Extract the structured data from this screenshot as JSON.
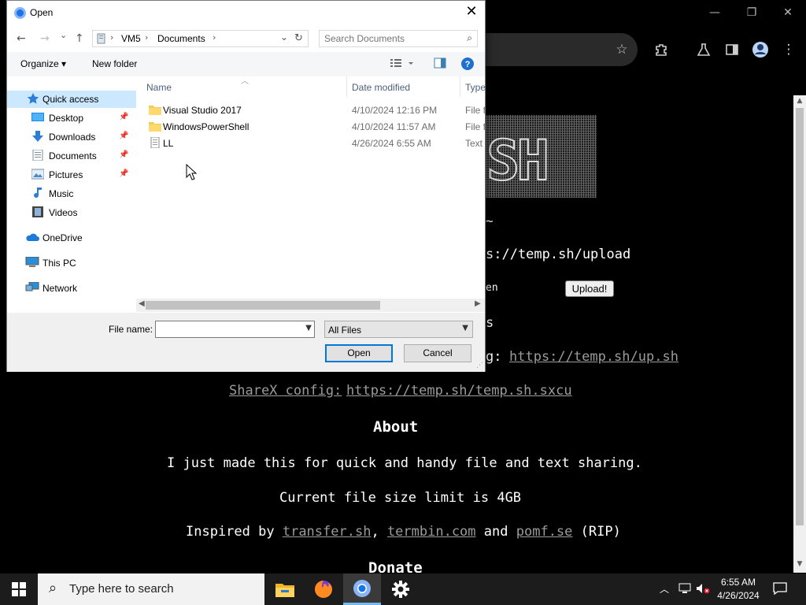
{
  "browser": {
    "window_controls": {
      "minimize": "—",
      "restore": "❐",
      "close": "✕"
    },
    "toolbar_icons": [
      "star-icon",
      "extensions-icon",
      "labs-icon",
      "sidepanel-icon",
      "profile-icon",
      "menu-icon"
    ]
  },
  "webpage": {
    "tilde": "~",
    "upload_url_fragment": "s://temp.sh/upload",
    "en_fragment": "en",
    "upload_button": "Upload!",
    "s_fragment": "s",
    "g_fragment": "g:",
    "upsh_link": "https://temp.sh/up.sh",
    "sharex_label": "ShareX config:",
    "sharex_link": "https://temp.sh/temp.sh.sxcu",
    "about_heading": "About",
    "about_text": "I just made this for quick and handy file and text sharing.",
    "limit_text": "Current file size limit is 4GB",
    "inspired_prefix": "Inspired by",
    "inspired_link1": "transfer.sh",
    "inspired_sep1": ",",
    "inspired_link2": "termbin.com",
    "inspired_and": "and",
    "inspired_link3": "pomf.se",
    "inspired_suffix": "(RIP)",
    "donate_heading": "Donate"
  },
  "dialog": {
    "title": "Open",
    "nav": {
      "back": "←",
      "forward": "→",
      "recent": "⌄",
      "up": "↑"
    },
    "breadcrumb": [
      "VM5",
      "Documents"
    ],
    "search_placeholder": "Search Documents",
    "commands": {
      "organize": "Organize ▾",
      "new_folder": "New folder"
    },
    "sidebar": [
      {
        "label": "Quick access",
        "icon": "star-icon",
        "selected": true,
        "pinned": false
      },
      {
        "label": "Desktop",
        "icon": "desktop-icon",
        "pinned": true
      },
      {
        "label": "Downloads",
        "icon": "download-icon",
        "pinned": true
      },
      {
        "label": "Documents",
        "icon": "documents-icon",
        "pinned": true
      },
      {
        "label": "Pictures",
        "icon": "pictures-icon",
        "pinned": true
      },
      {
        "label": "Music",
        "icon": "music-icon",
        "pinned": false
      },
      {
        "label": "Videos",
        "icon": "videos-icon",
        "pinned": false
      },
      {
        "label": "OneDrive",
        "icon": "cloud-icon",
        "pinned": false
      },
      {
        "label": "This PC",
        "icon": "computer-icon",
        "pinned": false
      },
      {
        "label": "Network",
        "icon": "network-icon",
        "pinned": false
      }
    ],
    "columns": {
      "name": "Name",
      "date": "Date modified",
      "type": "Type"
    },
    "files": [
      {
        "name": "Visual Studio 2017",
        "date": "4/10/2024 12:16 PM",
        "type": "File folder",
        "kind": "folder"
      },
      {
        "name": "WindowsPowerShell",
        "date": "4/10/2024 11:57 AM",
        "type": "File folder",
        "kind": "folder"
      },
      {
        "name": "LL",
        "date": "4/26/2024 6:55 AM",
        "type": "Text Document",
        "kind": "text"
      }
    ],
    "file_name_label": "File name:",
    "file_name_value": "",
    "filter_value": "All Files",
    "open_button": "Open",
    "cancel_button": "Cancel"
  },
  "taskbar": {
    "search_placeholder": "Type here to search",
    "apps": [
      "file-explorer-icon",
      "firefox-icon",
      "chrome-icon",
      "settings-icon"
    ],
    "time": "6:55 AM",
    "date": "4/26/2024"
  }
}
